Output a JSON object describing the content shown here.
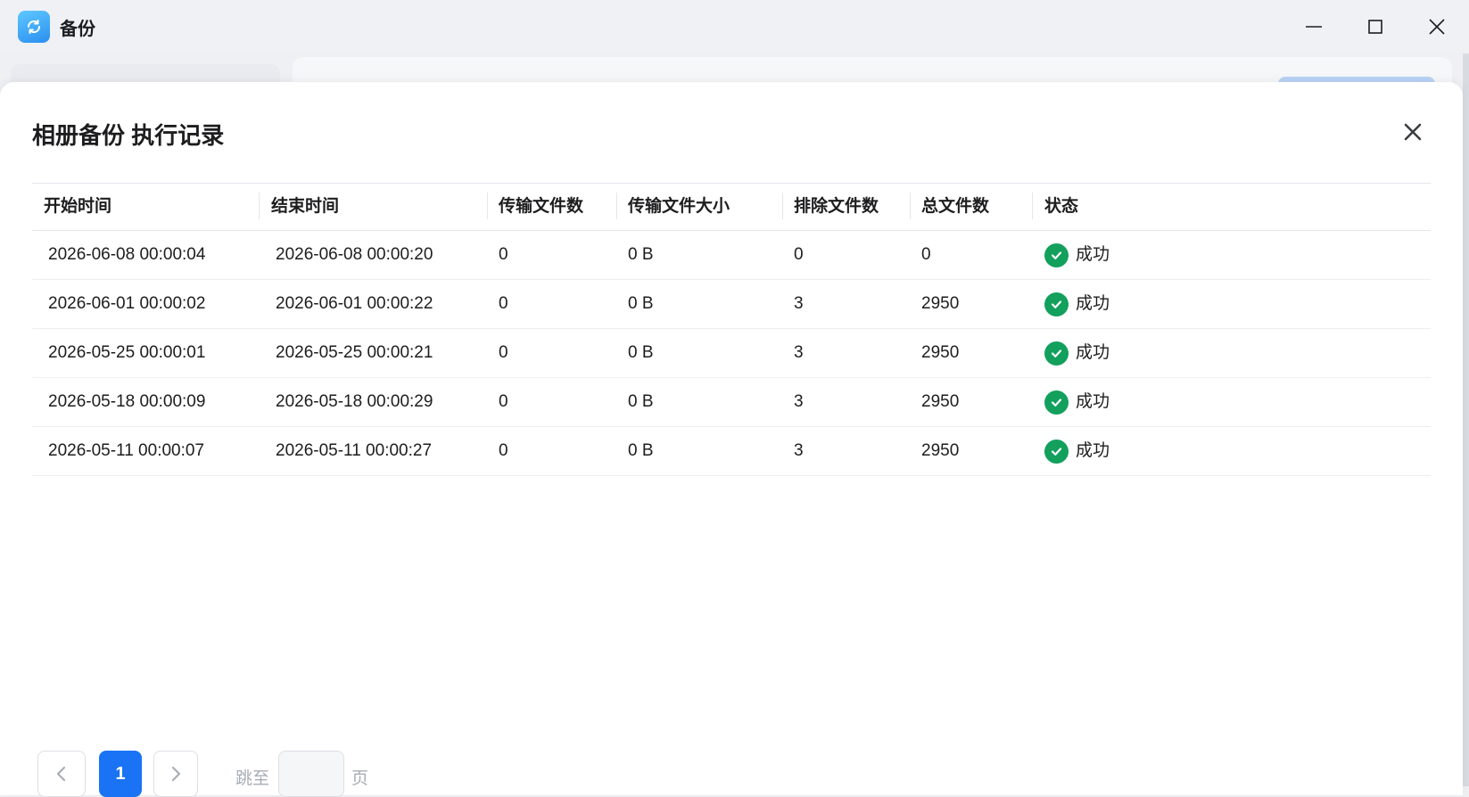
{
  "app": {
    "title": "备份"
  },
  "modal": {
    "title": "相册备份 执行记录"
  },
  "table": {
    "columns": [
      "开始时间",
      "结束时间",
      "传输文件数",
      "传输文件大小",
      "排除文件数",
      "总文件数",
      "状态"
    ],
    "rows": [
      [
        "2026-06-08 00:00:04",
        "2026-06-08 00:00:20",
        "0",
        "0 B",
        "0",
        "0",
        "成功"
      ],
      [
        "2026-06-01 00:00:02",
        "2026-06-01 00:00:22",
        "0",
        "0 B",
        "3",
        "2950",
        "成功"
      ],
      [
        "2026-05-25 00:00:01",
        "2026-05-25 00:00:21",
        "0",
        "0 B",
        "3",
        "2950",
        "成功"
      ],
      [
        "2026-05-18 00:00:09",
        "2026-05-18 00:00:29",
        "0",
        "0 B",
        "3",
        "2950",
        "成功"
      ],
      [
        "2026-05-11 00:00:07",
        "2026-05-11 00:00:27",
        "0",
        "0 B",
        "3",
        "2950",
        "成功"
      ]
    ]
  },
  "pagination": {
    "current_page": "1",
    "jump_label": "跳至",
    "jump_value": "",
    "page_suffix": "页"
  },
  "colors": {
    "accent": "#1a73f5",
    "success": "#12a05c"
  },
  "icons": {
    "app": "sync-icon",
    "status": "check-circle-icon"
  }
}
